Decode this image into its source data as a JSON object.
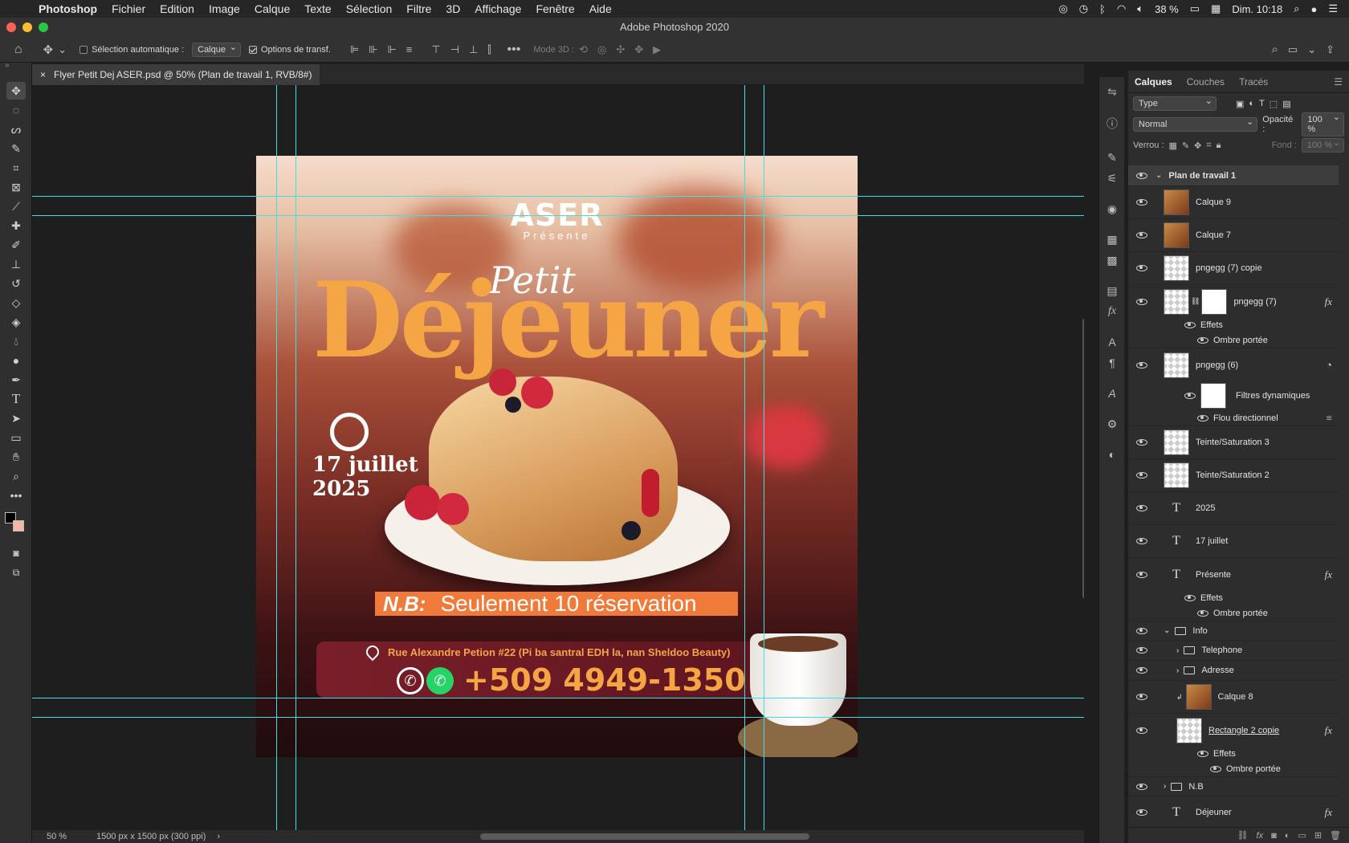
{
  "menubar": {
    "app": "Photoshop",
    "items": [
      "Fichier",
      "Edition",
      "Image",
      "Calque",
      "Texte",
      "Sélection",
      "Filtre",
      "3D",
      "Affichage",
      "Fenêtre",
      "Aide"
    ],
    "battery": "38 %",
    "datetime": "Dim. 10:18"
  },
  "window_title": "Adobe Photoshop 2020",
  "options": {
    "auto_select_label": "Sélection automatique :",
    "auto_select_value": "Calque",
    "transform_label": "Options de transf.",
    "mode3d_label": "Mode 3D :"
  },
  "document_tab": "Flyer Petit Dej ASER.psd @ 50% (Plan de travail 1, RVB/8#)",
  "status": {
    "zoom": "50 %",
    "size": "1500 px x 1500 px (300 ppi)"
  },
  "flyer": {
    "brand": "ASER",
    "presents": "Présente",
    "title_script": "Petit",
    "title": "Déjeuner",
    "date_day": "17 juillet",
    "date_year": "2025",
    "nb_label": "N.B:",
    "nb_text": "Seulement 10 réservation",
    "address": "Rue Alexandre  Petion #22 (Pi ba santral EDH la, nan Sheldoo Beauty)",
    "phone": "+509 4949-1350"
  },
  "panel": {
    "tabs": [
      "Calques",
      "Couches",
      "Tracés"
    ],
    "filter_kind": "Type",
    "blend_mode": "Normal",
    "opacity_label": "Opacité :",
    "opacity_value": "100 %",
    "lock_label": "Verrou :",
    "fill_label": "Fond :",
    "fill_value": "100 %",
    "layers": {
      "artboard": "Plan de travail 1",
      "l1": "Calque 9",
      "l2": "Calque 7",
      "l3": "pngegg (7) copie",
      "l4": "pngegg (7)",
      "l4_effects": "Effets",
      "l4_shadow": "Ombre portée",
      "l5": "pngegg (6)",
      "l5_filters": "Filtres dynamiques",
      "l5_blur": "Flou directionnel",
      "l6": "Teinte/Saturation 3",
      "l7": "Teinte/Saturation 2",
      "l8": "2025",
      "l9": "17 juillet",
      "l10": "Présente",
      "l10_effects": "Effets",
      "l10_shadow": "Ombre portée",
      "g_info": "Info",
      "g_tel": "Telephone",
      "g_addr": "Adresse",
      "l11": "Calque 8",
      "l12": "Rectangle 2 copie",
      "l12_effects": "Effets",
      "l12_shadow": "Ombre portée",
      "g_nb": "N.B",
      "l13": "Déjeuner"
    }
  },
  "colors": {
    "accent_orange": "#f6a545",
    "nb_bg": "#f07a3a",
    "guide": "#3fe0e0"
  }
}
